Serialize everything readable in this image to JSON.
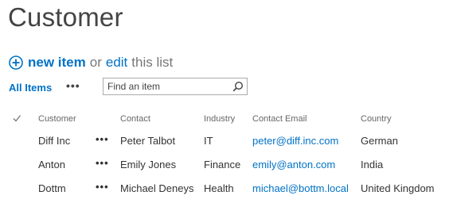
{
  "page": {
    "title": "Customer"
  },
  "actions": {
    "new_item": "new item",
    "or": "or",
    "edit": "edit",
    "this_list": "this list"
  },
  "views": {
    "current": "All Items",
    "more": "•••"
  },
  "search": {
    "placeholder": "Find an item",
    "value": ""
  },
  "table": {
    "columns": [
      "Customer",
      "Contact",
      "Industry",
      "Contact Email",
      "Country"
    ],
    "rows": [
      {
        "customer": "Diff Inc",
        "menu": "•••",
        "contact": "Peter Talbot",
        "industry": "IT",
        "email": "peter@diff.inc.com",
        "country": "German"
      },
      {
        "customer": "Anton",
        "menu": "•••",
        "contact": "Emily Jones",
        "industry": "Finance",
        "email": "emily@anton.com",
        "country": "India"
      },
      {
        "customer": "Dottm",
        "menu": "•••",
        "contact": "Michael Deneys",
        "industry": "Health",
        "email": "michael@bottm.local",
        "country": "United Kingdom"
      }
    ]
  },
  "colors": {
    "accent": "#0072c6",
    "text": "#444444",
    "muted": "#777777"
  },
  "icons": {
    "add": "plus-circle-icon",
    "search": "search-icon",
    "select_all": "checkmark-icon"
  }
}
